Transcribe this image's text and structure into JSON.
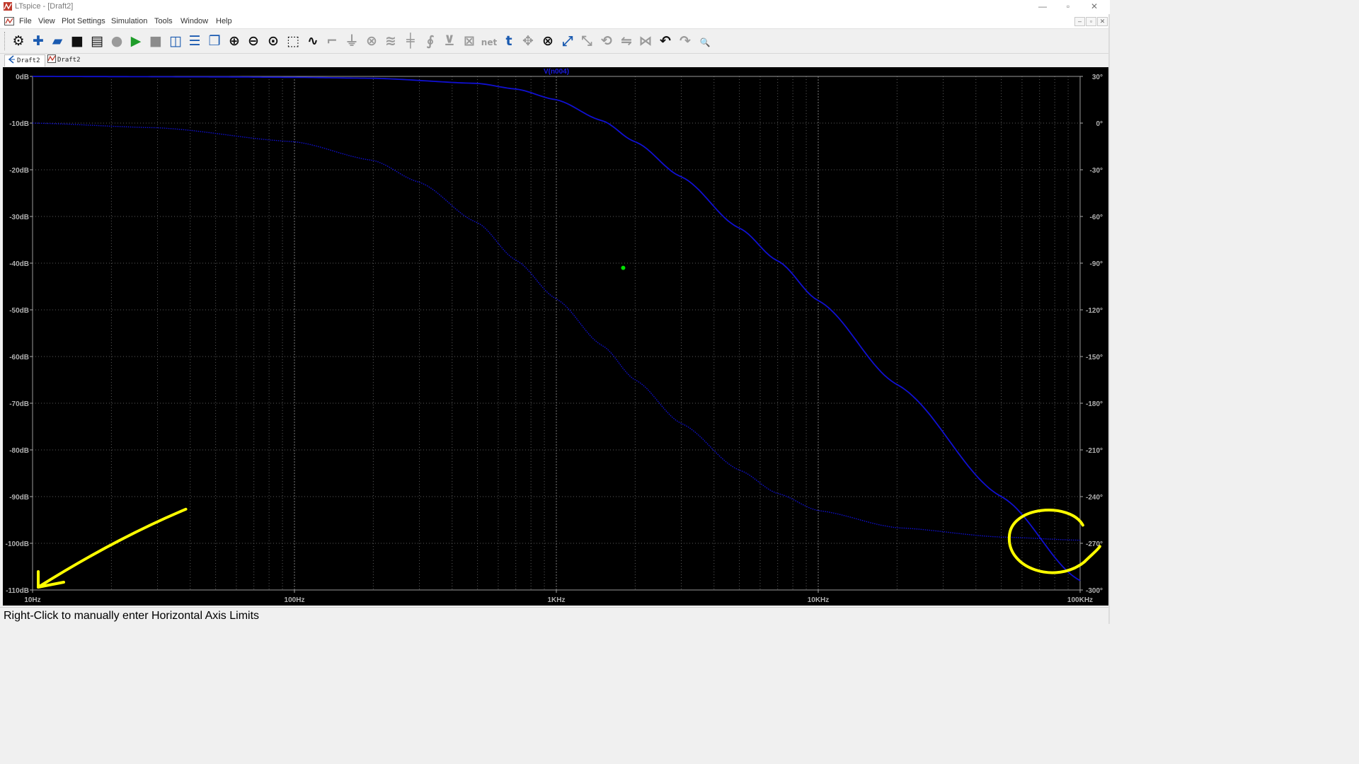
{
  "window": {
    "title": "LTspice - [Draft2]",
    "controls": {
      "minimize": "—",
      "restore": "▫",
      "close": "✕"
    }
  },
  "menubar": {
    "items": [
      "File",
      "View",
      "Plot Settings",
      "Simulation",
      "Tools",
      "Window",
      "Help"
    ],
    "mdi_controls": [
      "–",
      "▫",
      "✕"
    ]
  },
  "toolbar": {
    "buttons": [
      {
        "name": "settings-gear-icon",
        "glyph": "⚙",
        "color": "#111111"
      },
      {
        "name": "new-schematic-icon",
        "glyph": "✚",
        "color": "#1a5ab0"
      },
      {
        "name": "open-folder-icon",
        "glyph": "▰",
        "color": "#1a5ab0"
      },
      {
        "name": "save-icon",
        "glyph": "■",
        "color": "#111111"
      },
      {
        "name": "print-icon",
        "glyph": "▤",
        "color": "#111111"
      },
      {
        "name": "halt-icon",
        "glyph": "●",
        "color": "#9a9a9a"
      },
      {
        "name": "run-icon",
        "glyph": "▶",
        "color": "#1f9d2a"
      },
      {
        "name": "stop-icon",
        "glyph": "■",
        "color": "#8c8c8c"
      },
      {
        "name": "tile-vertical-icon",
        "glyph": "◫",
        "color": "#1a5ab0"
      },
      {
        "name": "tile-horizontal-icon",
        "glyph": "☰",
        "color": "#1a5ab0"
      },
      {
        "name": "cascade-icon",
        "glyph": "❐",
        "color": "#1a5ab0"
      },
      {
        "name": "zoom-in-icon",
        "glyph": "⊕",
        "color": "#111111"
      },
      {
        "name": "zoom-out-icon",
        "glyph": "⊖",
        "color": "#111111"
      },
      {
        "name": "zoom-fit-icon",
        "glyph": "⊙",
        "color": "#111111"
      },
      {
        "name": "autorange-icon",
        "glyph": "⬚",
        "color": "#111111"
      },
      {
        "name": "waveform-icon",
        "glyph": "∿",
        "color": "#111111"
      },
      {
        "name": "wire-icon",
        "glyph": "⌐",
        "color": "#9a9a9a"
      },
      {
        "name": "ground-icon",
        "glyph": "⏚",
        "color": "#9a9a9a"
      },
      {
        "name": "component-icon",
        "glyph": "⊗",
        "color": "#9a9a9a"
      },
      {
        "name": "resistor-icon",
        "glyph": "≋",
        "color": "#9a9a9a"
      },
      {
        "name": "capacitor-icon",
        "glyph": "╪",
        "color": "#9a9a9a"
      },
      {
        "name": "inductor-icon",
        "glyph": "∮",
        "color": "#9a9a9a"
      },
      {
        "name": "diode-icon",
        "glyph": "⊻",
        "color": "#9a9a9a"
      },
      {
        "name": "component-box-icon",
        "glyph": "⊠",
        "color": "#9a9a9a"
      },
      {
        "name": "net-label-icon",
        "glyph": "net",
        "color": "#9a9a9a"
      },
      {
        "name": "text-icon",
        "glyph": "t",
        "color": "#1a5ab0"
      },
      {
        "name": "move-icon",
        "glyph": "✥",
        "color": "#9a9a9a"
      },
      {
        "name": "delete-icon",
        "glyph": "⊗",
        "color": "#111111"
      },
      {
        "name": "duplicate-icon",
        "glyph": "⤢",
        "color": "#1a5ab0"
      },
      {
        "name": "drag-icon",
        "glyph": "⤡",
        "color": "#9a9a9a"
      },
      {
        "name": "rotate-icon",
        "glyph": "⟲",
        "color": "#9a9a9a"
      },
      {
        "name": "mirror-icon",
        "glyph": "⇋",
        "color": "#9a9a9a"
      },
      {
        "name": "flip-icon",
        "glyph": "⋈",
        "color": "#9a9a9a"
      },
      {
        "name": "undo-icon",
        "glyph": "↶",
        "color": "#111111"
      },
      {
        "name": "redo-icon",
        "glyph": "↷",
        "color": "#9a9a9a"
      },
      {
        "name": "find-icon",
        "glyph": "🔍",
        "color": "#1a5ab0"
      }
    ]
  },
  "tabs": [
    {
      "label": "Draft2",
      "icon": "schematic-tab-icon",
      "active": true
    },
    {
      "label": "Draft2",
      "icon": "waveform-tab-icon",
      "active": false
    }
  ],
  "statusbar": {
    "message": "Right-Click to manually enter Horizontal Axis Limits"
  },
  "chart_data": {
    "type": "line",
    "title": "V(n004)",
    "xscale": "log",
    "xlim": [
      10,
      100000
    ],
    "x_ticks": [
      "10Hz",
      "100Hz",
      "1KHz",
      "10KHz",
      "100KHz"
    ],
    "ylim": [
      -110,
      0
    ],
    "y_ticks": [
      "0dB",
      "-10dB",
      "-20dB",
      "-30dB",
      "-40dB",
      "-50dB",
      "-60dB",
      "-70dB",
      "-80dB",
      "-90dB",
      "-100dB",
      "-110dB"
    ],
    "y2lim": [
      -300,
      30
    ],
    "y2_ticks": [
      "30°",
      "0°",
      "-30°",
      "-60°",
      "-90°",
      "-120°",
      "-150°",
      "-180°",
      "-210°",
      "-240°",
      "-270°",
      "-300°"
    ],
    "grid": true,
    "background": "#000000",
    "series_color": "#1010d0",
    "series": [
      {
        "name": "V(n004)",
        "style": "solid",
        "axis": "left",
        "x": [
          10,
          50,
          100,
          200,
          500,
          700,
          1000,
          1500,
          2000,
          3000,
          5000,
          7000,
          10000,
          20000,
          50000,
          100000
        ],
        "y": [
          0,
          -0.1,
          -0.2,
          -0.4,
          -1.5,
          -2.7,
          -5.0,
          -9.5,
          -14,
          -21.5,
          -32.5,
          -39.5,
          -48,
          -66,
          -90,
          -108
        ]
      },
      {
        "name": "V(n004) phase",
        "style": "dotted",
        "axis": "right",
        "x": [
          10,
          30,
          100,
          200,
          300,
          500,
          700,
          1000,
          1500,
          2000,
          3000,
          5000,
          7000,
          10000,
          20000,
          50000,
          100000
        ],
        "y": [
          0,
          -3,
          -12,
          -24,
          -38,
          -64,
          -88,
          -113,
          -143,
          -165,
          -193,
          -223,
          -238,
          -249,
          -260,
          -266,
          -268
        ]
      }
    ],
    "cursor_marker": {
      "x": 1800,
      "y": -41,
      "color": "#00e000"
    },
    "annotations": [
      {
        "type": "arrow",
        "color": "#ffff00",
        "from": {
          "x": 30,
          "y": -93
        },
        "to": {
          "x": 10,
          "y": -110
        }
      },
      {
        "type": "ellipse",
        "color": "#ffff00",
        "center": {
          "x": 85000,
          "y": -99
        }
      }
    ]
  }
}
